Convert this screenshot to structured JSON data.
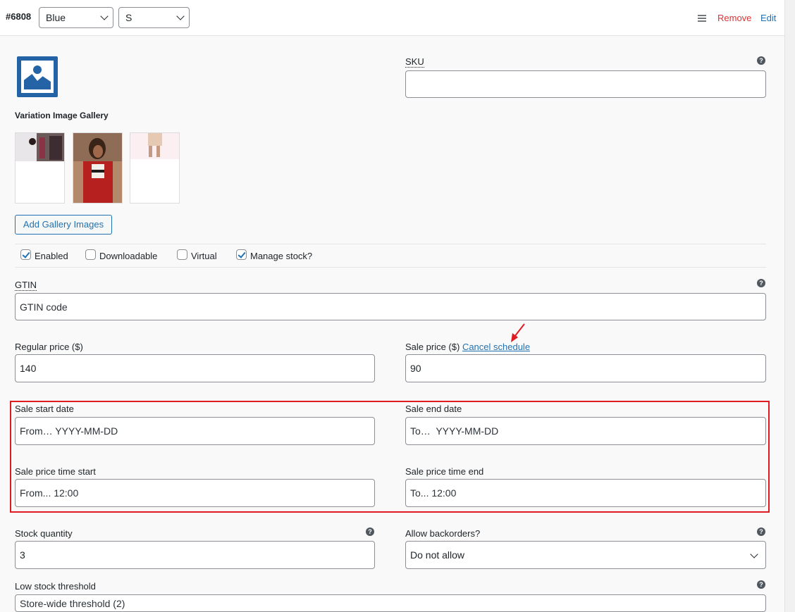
{
  "header": {
    "variation_id": "#6808",
    "color_value": "Blue",
    "size_value": "S",
    "remove_label": "Remove",
    "edit_label": "Edit"
  },
  "media": {
    "gallery_label": "Variation Image Gallery",
    "add_gallery_label": "Add Gallery Images"
  },
  "sku": {
    "label": "SKU",
    "value": ""
  },
  "options": {
    "enabled": {
      "label": "Enabled",
      "checked": true
    },
    "downloadable": {
      "label": "Downloadable",
      "checked": false
    },
    "virtual": {
      "label": "Virtual",
      "checked": false
    },
    "manage_stock": {
      "label": "Manage stock?",
      "checked": true
    }
  },
  "gtin": {
    "label": "GTIN",
    "placeholder": "GTIN code"
  },
  "regular_price": {
    "label": "Regular price ($)",
    "value": "140"
  },
  "sale_price": {
    "label": "Sale price ($)",
    "cancel_label": "Cancel schedule",
    "value": "90"
  },
  "sale_dates": {
    "start_label": "Sale start date",
    "start_placeholder": "From… YYYY-MM-DD",
    "end_label": "Sale end date",
    "end_placeholder": "To…  YYYY-MM-DD",
    "time_start_label": "Sale price time start",
    "time_start_placeholder": "From... 12:00",
    "time_end_label": "Sale price time end",
    "time_end_placeholder": "To... 12:00"
  },
  "stock": {
    "label": "Stock quantity",
    "value": "3"
  },
  "backorders": {
    "label": "Allow backorders?",
    "value": "Do not allow"
  },
  "low_stock": {
    "label": "Low stock threshold",
    "placeholder": "Store-wide threshold (2)"
  },
  "colors": {
    "accent": "#2271b1",
    "danger": "#d63638",
    "highlight": "#e01b24"
  }
}
